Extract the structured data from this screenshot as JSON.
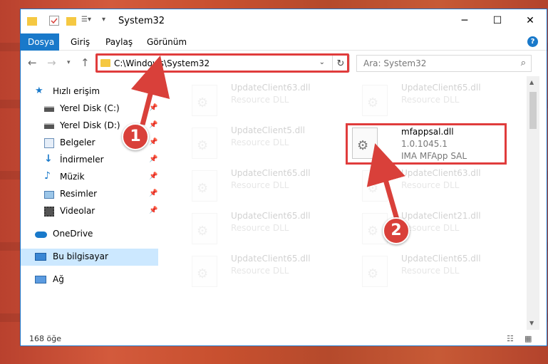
{
  "window": {
    "title": "System32"
  },
  "ribbon": {
    "tabs": [
      "Dosya",
      "Giriş",
      "Paylaş",
      "Görünüm"
    ],
    "help": "?"
  },
  "address": {
    "path": "C:\\Windows\\System32"
  },
  "search": {
    "placeholder": "Ara: System32"
  },
  "sidebar": {
    "items": [
      {
        "label": "Hızlı erişim",
        "icon": "star-icon"
      },
      {
        "label": "Yerel Disk (C:)",
        "icon": "drive-icon"
      },
      {
        "label": "Yerel Disk (D:)",
        "icon": "drive-icon"
      },
      {
        "label": "Belgeler",
        "icon": "documents-icon"
      },
      {
        "label": "İndirmeler",
        "icon": "download-icon"
      },
      {
        "label": "Müzik",
        "icon": "music-icon"
      },
      {
        "label": "Resimler",
        "icon": "pictures-icon"
      },
      {
        "label": "Videolar",
        "icon": "video-icon"
      },
      {
        "label": "OneDrive",
        "icon": "cloud-icon"
      },
      {
        "label": "Bu bilgisayar",
        "icon": "computer-icon"
      },
      {
        "label": "Ağ",
        "icon": "network-icon"
      }
    ]
  },
  "files": [
    {
      "name": "UpdateClient63.dll",
      "desc": "Resource DLL",
      "comp": ""
    },
    {
      "name": "UpdateClient65.dll",
      "desc": "Resource DLL",
      "comp": ""
    },
    {
      "name": "UpdateClient5.dll",
      "desc": "Resource DLL",
      "comp": ""
    },
    {
      "name": "mfappsal.dll",
      "desc": "1.0.1045.1",
      "comp": "IMA MFApp SAL"
    },
    {
      "name": "UpdateClient65.dll",
      "desc": "Resource DLL",
      "comp": ""
    },
    {
      "name": "UpdateClient63.dll",
      "desc": "Resource DLL",
      "comp": ""
    },
    {
      "name": "UpdateClient65.dll",
      "desc": "Resource DLL",
      "comp": ""
    },
    {
      "name": "UpdateClient21.dll",
      "desc": "Resource DLL",
      "comp": ""
    },
    {
      "name": "UpdateClient65.dll",
      "desc": "Resource DLL",
      "comp": ""
    },
    {
      "name": "UpdateClient65.dll",
      "desc": "Resource DLL",
      "comp": ""
    }
  ],
  "status": {
    "count": "168 öğe"
  },
  "callouts": {
    "one": "1",
    "two": "2"
  },
  "colors": {
    "accent": "#1979ca",
    "highlight": "#e03c3c",
    "selection": "#cce8ff"
  }
}
